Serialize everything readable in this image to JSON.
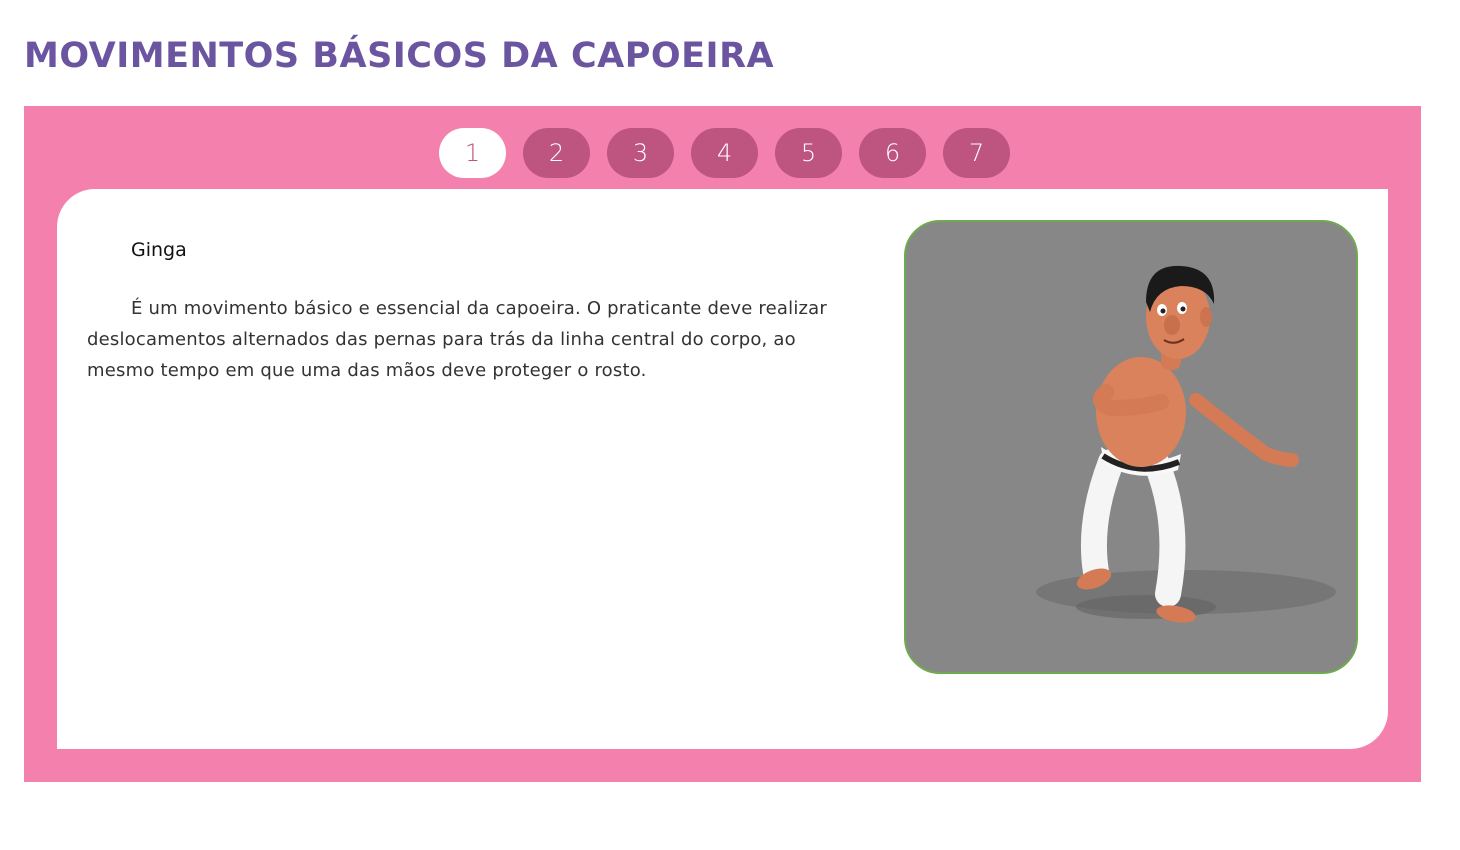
{
  "page": {
    "title": "MOVIMENTOS BÁSICOS DA CAPOEIRA"
  },
  "tabs": [
    {
      "label": "1",
      "active": true
    },
    {
      "label": "2",
      "active": false
    },
    {
      "label": "3",
      "active": false
    },
    {
      "label": "4",
      "active": false
    },
    {
      "label": "5",
      "active": false
    },
    {
      "label": "6",
      "active": false
    },
    {
      "label": "7",
      "active": false
    }
  ],
  "content": {
    "move_title": "Ginga",
    "move_description": "É um movimento básico e essencial da capoeira. O praticante deve realizar deslocamentos alternados das pernas para trás da linha central do corpo, ao mesmo tempo em que uma das mãos deve proteger o rosto."
  },
  "colors": {
    "title": "#6b55a0",
    "panel_bg": "#f481ad",
    "tab_bg": "#bd5580",
    "tab_active_bg": "#ffffff",
    "image_border": "#6faa4e",
    "image_bg": "#878787"
  },
  "image": {
    "depicts": "3d-capoeira-character-ginga"
  }
}
